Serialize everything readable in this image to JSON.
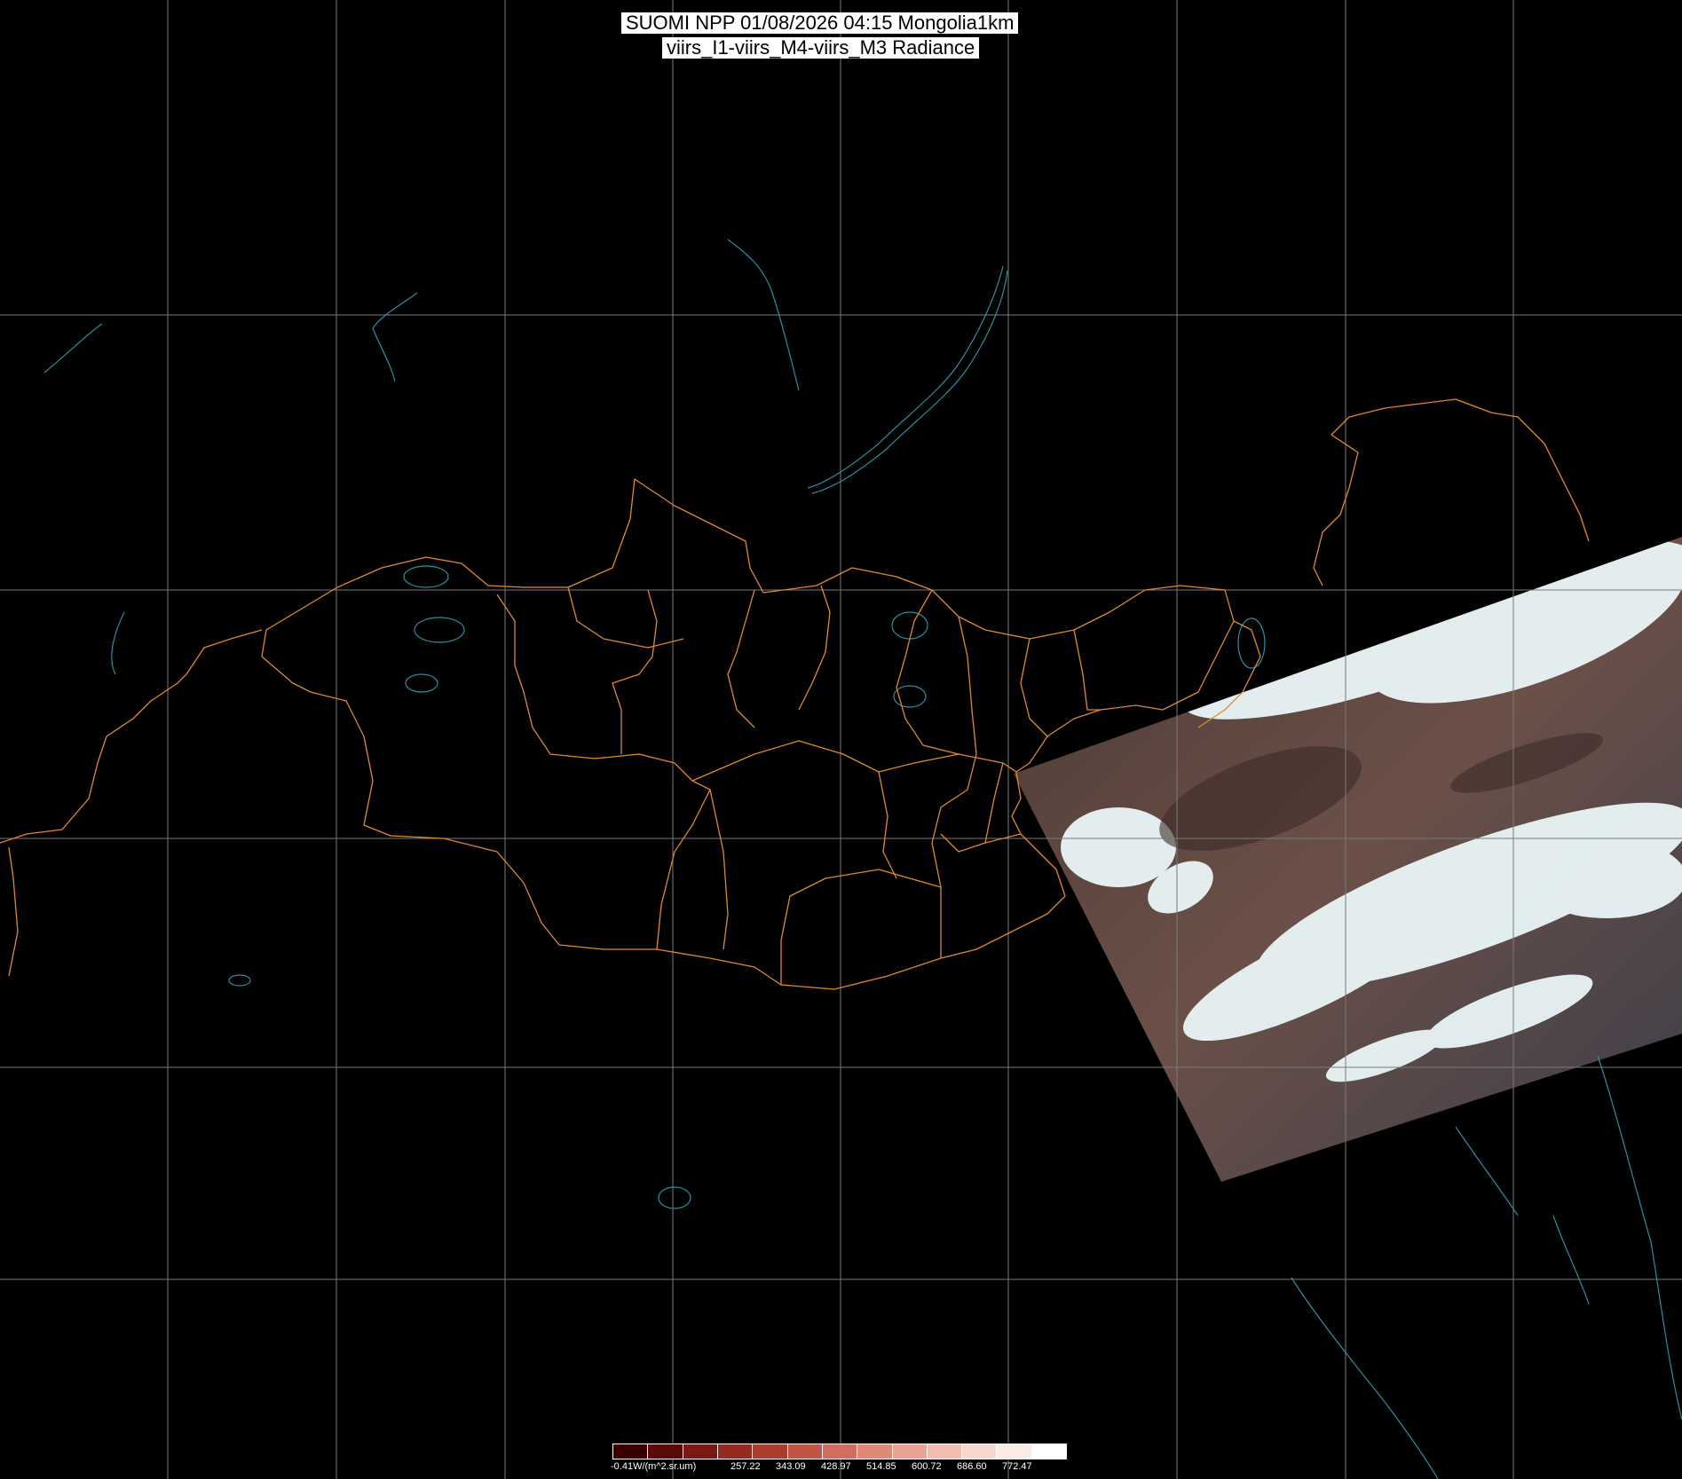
{
  "title": {
    "line1": "SUOMI NPP 01/08/2026 04:15 Mongolia1km",
    "line2": "viirs_I1-viirs_M4-viirs_M3 Radiance"
  },
  "colors": {
    "background": "#000000",
    "grid": "#7a7a7a",
    "boundary": "#e08a2c",
    "water": "#2a8fa0",
    "cloud": "#e6f4f7",
    "land": "#5a3d30"
  },
  "colorbar": {
    "unit_label": "-0.41W/(m^2.sr.um)",
    "ticks": [
      "257.22",
      "343.09",
      "428.97",
      "514.85",
      "600.72",
      "686.60",
      "772.47"
    ],
    "colors": [
      "#3a0000",
      "#5a0a08",
      "#7a1a14",
      "#952a20",
      "#ad3c30",
      "#c25446",
      "#d26c5e",
      "#df887a",
      "#e9a396",
      "#f1bdb3",
      "#f7d6cf",
      "#fbebe7",
      "#ffffff"
    ]
  }
}
